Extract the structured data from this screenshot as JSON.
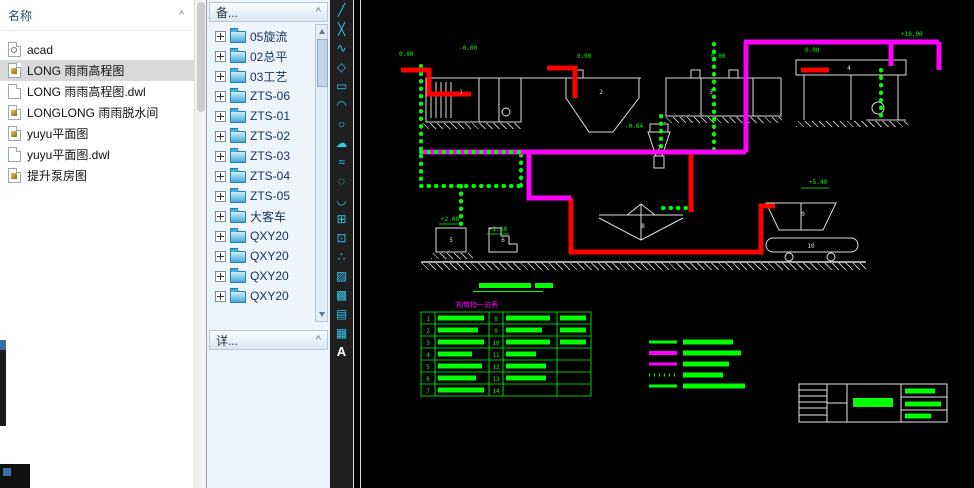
{
  "colors": {
    "pipe_green": "#00ff00",
    "pipe_magenta": "#ff00ff",
    "pipe_red": "#ff0000",
    "structure_white": "#dedede",
    "toolbar_icon_cyan": "#35c4f0",
    "canvas_bg": "#000000",
    "palette_bg": "#eef4fb",
    "selection_gray": "#d9d9d9"
  },
  "file_panel": {
    "header": "名称",
    "sort_glyph": "^",
    "items": [
      {
        "label": "acad",
        "type": "acad"
      },
      {
        "label": "LONG 雨雨高程图",
        "type": "dwg",
        "selected": true
      },
      {
        "label": "LONG 雨雨高程图.dwl",
        "type": "dwl"
      },
      {
        "label": "LONGLONG 雨雨脱水间",
        "type": "dwg"
      },
      {
        "label": "yuyu平面图",
        "type": "dwg"
      },
      {
        "label": "yuyu平面图.dwl",
        "type": "dwl"
      },
      {
        "label": "提升泵房图",
        "type": "dwg"
      }
    ]
  },
  "palette": {
    "top_header": "备...",
    "bottom_header": "详...",
    "collapse_glyph": "^",
    "tree_items": [
      "05旋流",
      "02总平",
      "03工艺",
      "ZTS-06",
      "ZTS-01",
      "ZTS-02",
      "ZTS-03",
      "ZTS-04",
      "ZTS-05",
      "大客车",
      "QXY20",
      "QXY20",
      "QXY20",
      "QXY20"
    ]
  },
  "toolbar": {
    "icons": [
      {
        "name": "line",
        "glyph": "╱"
      },
      {
        "name": "construction-line",
        "glyph": "╳"
      },
      {
        "name": "polyline",
        "glyph": "∿"
      },
      {
        "name": "polygon",
        "glyph": "◇"
      },
      {
        "name": "rectangle",
        "glyph": "▭"
      },
      {
        "name": "arc",
        "glyph": "◠"
      },
      {
        "name": "circle",
        "glyph": "○"
      },
      {
        "name": "revision-cloud",
        "glyph": "☁"
      },
      {
        "name": "spline",
        "glyph": "≈"
      },
      {
        "name": "ellipse",
        "glyph": "◌"
      },
      {
        "name": "ellipse-arc",
        "glyph": "◡"
      },
      {
        "name": "insert-block",
        "glyph": "⊞"
      },
      {
        "name": "make-block",
        "glyph": "⊡"
      },
      {
        "name": "point",
        "glyph": "∴"
      },
      {
        "name": "hatch",
        "glyph": "▨"
      },
      {
        "name": "gradient",
        "glyph": "▩"
      },
      {
        "name": "region",
        "glyph": "▤"
      },
      {
        "name": "table",
        "glyph": "▦"
      },
      {
        "name": "mtext",
        "glyph": "A"
      }
    ]
  },
  "canvas": {
    "elevations": [
      "0.00",
      "-0.00",
      "0.00",
      "0.00",
      "0.00",
      "+10.00",
      "+5.40",
      "+2.00",
      "+1.30",
      "-0.64"
    ],
    "numbers": [
      "1",
      "2",
      "3",
      "4",
      "5",
      "6",
      "7",
      "8",
      "9",
      "10"
    ],
    "table": {
      "title": "构筑物一览表",
      "left_nums": [
        "1",
        "2",
        "3",
        "4",
        "5",
        "6",
        "7"
      ],
      "right_nums": [
        "8",
        "9",
        "10",
        "11",
        "12",
        "13",
        "14"
      ]
    }
  }
}
